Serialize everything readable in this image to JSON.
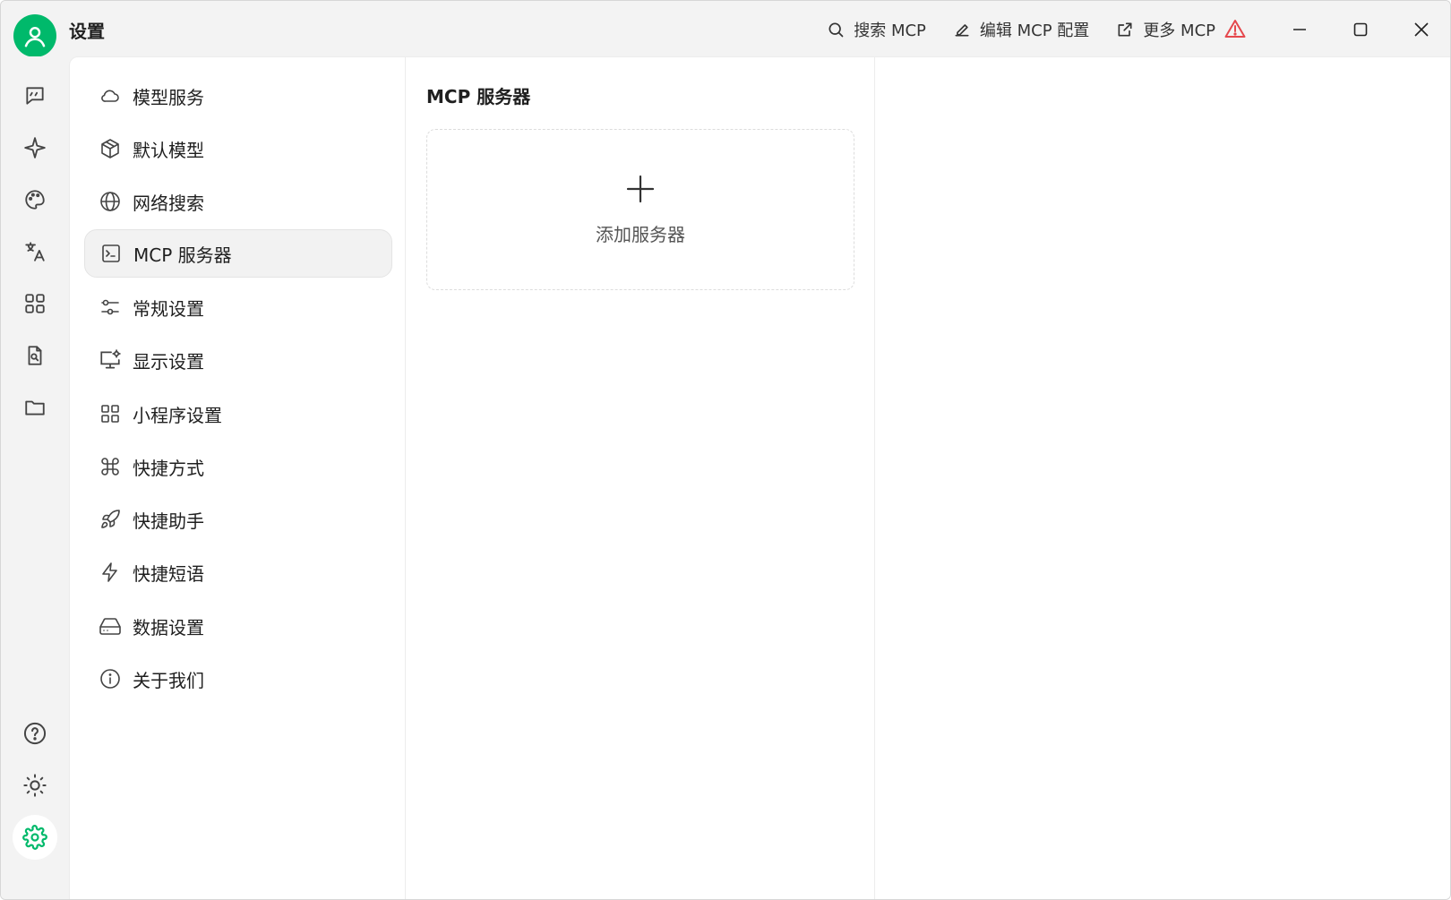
{
  "app": {
    "title": "设置"
  },
  "toolbar": {
    "actions": [
      {
        "icon": "search-icon",
        "label": "搜索 MCP"
      },
      {
        "icon": "edit-icon",
        "label": "编辑 MCP 配置"
      },
      {
        "icon": "external-link-icon",
        "label": "更多 MCP"
      }
    ],
    "warning_icon": "warning-icon"
  },
  "rail": {
    "items": [
      {
        "icon": "chat-icon"
      },
      {
        "icon": "sparkle-icon"
      },
      {
        "icon": "palette-icon"
      },
      {
        "icon": "translate-icon"
      },
      {
        "icon": "apps-grid-icon"
      },
      {
        "icon": "file-search-icon"
      },
      {
        "icon": "folder-icon"
      }
    ],
    "bottom": [
      {
        "icon": "help-icon"
      },
      {
        "icon": "theme-sun-icon"
      },
      {
        "icon": "settings-gear-icon",
        "active": true
      }
    ]
  },
  "menu": {
    "items": [
      {
        "icon": "cloud-icon",
        "label": "模型服务"
      },
      {
        "icon": "cube-icon",
        "label": "默认模型"
      },
      {
        "icon": "globe-icon",
        "label": "网络搜索"
      },
      {
        "icon": "terminal-icon",
        "label": "MCP 服务器",
        "active": true
      },
      {
        "icon": "sliders-icon",
        "label": "常规设置"
      },
      {
        "icon": "monitor-settings-icon",
        "label": "显示设置"
      },
      {
        "icon": "grid-icon",
        "label": "小程序设置"
      },
      {
        "icon": "command-icon",
        "label": "快捷方式"
      },
      {
        "icon": "rocket-icon",
        "label": "快捷助手"
      },
      {
        "icon": "zap-icon",
        "label": "快捷短语"
      },
      {
        "icon": "hard-drive-icon",
        "label": "数据设置"
      },
      {
        "icon": "info-icon",
        "label": "关于我们"
      }
    ]
  },
  "mcp": {
    "title": "MCP 服务器",
    "add_label": "添加服务器"
  },
  "colors": {
    "accent": "#00b96b",
    "warning": "#e5484d"
  }
}
